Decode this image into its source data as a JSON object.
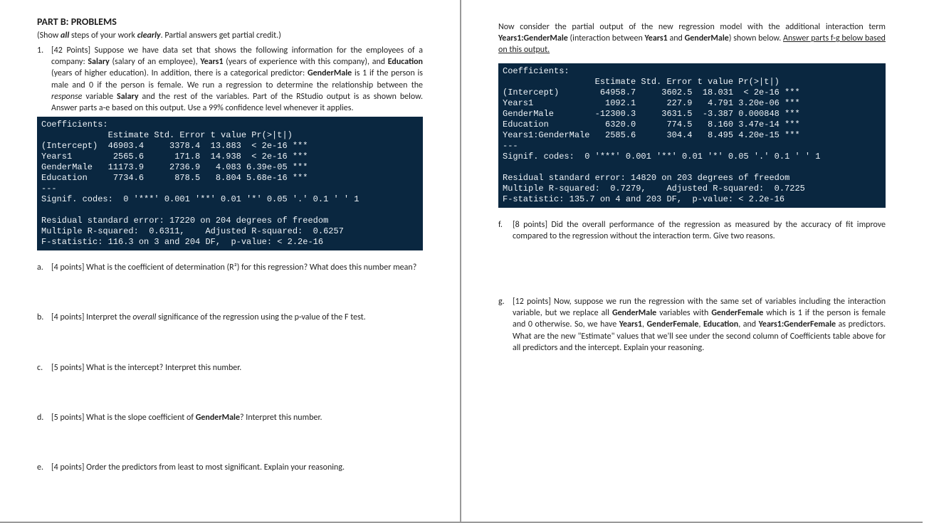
{
  "left": {
    "heading": "PART B: PROBLEMS",
    "instruction_prefix": "(Show ",
    "instruction_all": "all",
    "instruction_mid": " steps of your work ",
    "instruction_clearly": "clearly",
    "instruction_suffix": ". Partial answers get partial credit.)",
    "q1_num": "1.",
    "q1_text_1": "[42 Points] Suppose we have data set that shows the following information for the employees of a company: ",
    "q1_salary": "Salary",
    "q1_text_2": " (salary of an employee), ",
    "q1_years1": "Years1",
    "q1_text_3": " (years of experience with this company), and ",
    "q1_education": "Education",
    "q1_text_4": " (years of higher education). In addition, there is a categorical predictor: ",
    "q1_gendermale": "GenderMale",
    "q1_text_5": " is 1 if the person is male and 0 if the person is female. We run a regression to determine the relationship between the ",
    "q1_response": "response",
    "q1_text_6": " variable ",
    "q1_salary2": "Salary",
    "q1_text_7": " and the rest of the variables. Part of the RStudio output is as shown below. Answer parts a-e based on this output. Use a 99% confidence level whenever it applies.",
    "r1_line1": "Coefficients:",
    "r1_line2": "             Estimate Std. Error t value Pr(>|t|)    ",
    "r1_line3": "(Intercept)  46903.4     3378.4  13.883  < 2e-16 ***",
    "r1_line4": "Years1        2565.6      171.8  14.938  < 2e-16 ***",
    "r1_line5": "GenderMale   11173.9     2736.9   4.083 6.39e-05 ***",
    "r1_line6": "Education     7734.6      878.5   8.804 5.68e-16 ***",
    "r1_line7": "---",
    "r1_line8": "Signif. codes:  0 '***' 0.001 '**' 0.01 '*' 0.05 '.' 0.1 ' ' 1",
    "r1_line9": "",
    "r1_line10": "Residual standard error: 17220 on 204 degrees of freedom",
    "r1_line11": "Multiple R-squared:  0.6311,    Adjusted R-squared:  0.6257",
    "r1_line12": "F-statistic: 116.3 on 3 and 204 DF,  p-value: < 2.2e-16",
    "a_letter": "a.",
    "a_text": "[4 points] What is the coefficient of determination (R²) for this regression? What does this number mean?",
    "b_letter": "b.",
    "b_text_1": "[4 points] Interpret the ",
    "b_overall": "overall",
    "b_text_2": " significance of the regression using the p-value of the F test.",
    "c_letter": "c.",
    "c_text": "[5 points] What is the intercept? Interpret this number.",
    "d_letter": "d.",
    "d_text_1": "[5 points] What is the slope coefficient of ",
    "d_gendermale": "GenderMale",
    "d_text_2": "? Interpret this number.",
    "e_letter": "e.",
    "e_text": "[4 points] Order the predictors from least to most significant. Explain your reasoning."
  },
  "right": {
    "intro_1": "Now consider the partial output of the new regression model with the additional interaction term ",
    "intro_bold1": "Years1:GenderMale",
    "intro_2": " (interaction between ",
    "intro_bold2": "Years1",
    "intro_3": " and ",
    "intro_bold3": "GenderMale",
    "intro_4": ") shown below. ",
    "intro_underline": "Answer parts f-g below based on this output.",
    "r2_line1": "Coefficients:",
    "r2_line2": "                  Estimate Std. Error t value Pr(>|t|)    ",
    "r2_line3": "(Intercept)        64958.7     3602.5  18.031  < 2e-16 ***",
    "r2_line4": "Years1              1092.1      227.9   4.791 3.20e-06 ***",
    "r2_line5": "GenderMale        -12300.3     3631.5  -3.387 0.000848 ***",
    "r2_line6": "Education           6320.0      774.5   8.160 3.47e-14 ***",
    "r2_line7": "Years1:GenderMale   2585.6      304.4   8.495 4.20e-15 ***",
    "r2_line8": "---",
    "r2_line9": "Signif. codes:  0 '***' 0.001 '**' 0.01 '*' 0.05 '.' 0.1 ' ' 1",
    "r2_line10": "",
    "r2_line11": "Residual standard error: 14820 on 203 degrees of freedom",
    "r2_line12": "Multiple R-squared:  0.7279,    Adjusted R-squared:  0.7225",
    "r2_line13": "F-statistic: 135.7 on 4 and 203 DF,  p-value: < 2.2e-16",
    "f_letter": "f.",
    "f_text": "[8 points] Did the overall performance of the regression as measured by the accuracy of fit improve compared to the regression without the interaction term. Give two reasons.",
    "g_letter": "g.",
    "g_text_1": "[12 points] Now, suppose we run the regression with the same set of variables including the interaction variable, but we replace all ",
    "g_b1": "GenderMale",
    "g_text_2": " variables with ",
    "g_b2": "GenderFemale",
    "g_text_3": " which is 1 if the person is female and 0 otherwise. So, we have ",
    "g_b3": "Years1",
    "g_text_4": ", ",
    "g_b4": "GenderFemale",
    "g_text_5": ", ",
    "g_b5": "Education",
    "g_text_6": ", and ",
    "g_b6": "Years1:GenderFemale",
    "g_text_7": " as predictors. What are the new \"Estimate\" values that we'll see under the second column of Coefficients table above for all predictors and the intercept. Explain your reasoning."
  }
}
